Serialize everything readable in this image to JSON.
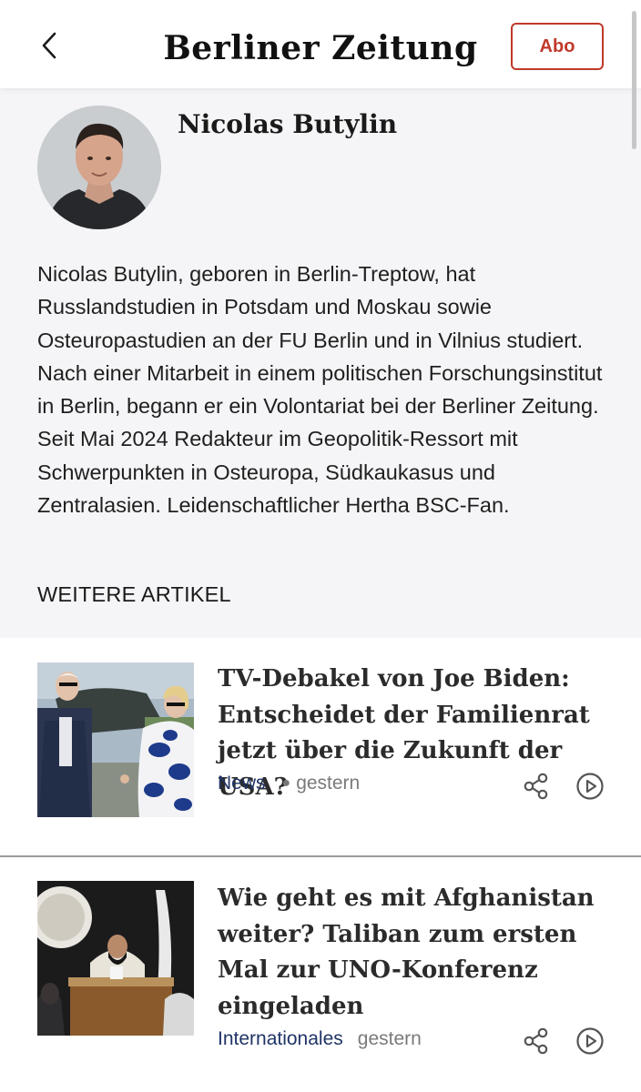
{
  "header": {
    "back_icon": "chevron-left-icon",
    "logo_text": "Berliner Zeitung",
    "abo_label": "Abo",
    "accent_color": "#c0392b"
  },
  "author": {
    "name": "Nicolas Butylin",
    "bio": "Nicolas Butylin, geboren in Berlin-Treptow, hat Russlandstudien in Potsdam und Moskau sowie Osteuropastudien an der FU Berlin und in Vilnius studiert. Nach einer Mitarbeit in einem politischen Forschungsinstitut in Berlin, begann er ein Volontariat bei der Berliner Zeitung. Seit Mai 2024 Redakteur im Geopolitik-Ressort mit Schwerpunkten in Osteuropa, Südkaukasus und Zentralasien. Leidenschaftlicher Hertha BSC-Fan.",
    "more_articles_label": "WEITERE ARTIKEL"
  },
  "articles": [
    {
      "headline": "TV-Debakel von Joe Biden: Entscheidet der Familienrat jetzt über die Zukunft der USA?",
      "category": "News",
      "time": "gestern",
      "share_icon": "share-icon",
      "play_icon": "play-circle-icon"
    },
    {
      "headline": "Wie geht es mit Afghanistan weiter? Taliban zum ersten Mal zur UNO-Konferenz eingeladen",
      "category": "Internationales",
      "time": "gestern",
      "share_icon": "share-icon",
      "play_icon": "play-circle-icon"
    }
  ],
  "colors": {
    "category": "#1f3466",
    "author_background": "#f5f5f7"
  }
}
